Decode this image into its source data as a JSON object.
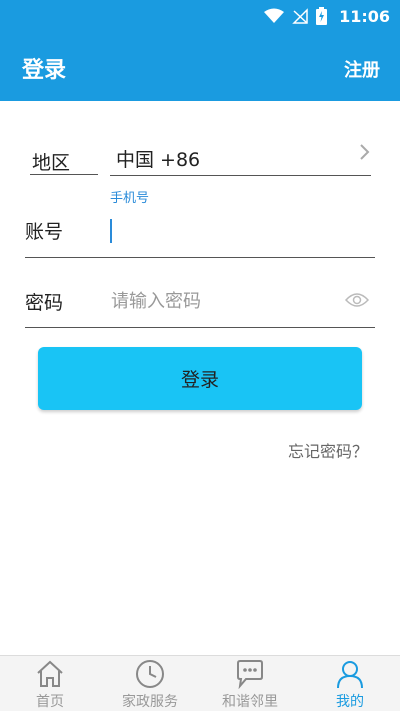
{
  "status_bar": {
    "time": "11:06"
  },
  "header": {
    "title": "登录",
    "register_label": "注册"
  },
  "form": {
    "region_label": "地区",
    "region_value": "中国 +86",
    "phone_hint": "手机号",
    "account_label": "账号",
    "account_value": "",
    "password_label": "密码",
    "password_placeholder": "请输入密码"
  },
  "login_button": "登录",
  "forgot_password": "忘记密码？",
  "tabs": [
    {
      "label": "首页",
      "icon": "home-icon",
      "active": false
    },
    {
      "label": "家政服务",
      "icon": "clock-icon",
      "active": false
    },
    {
      "label": "和谐邻里",
      "icon": "chat-icon",
      "active": false
    },
    {
      "label": "我的",
      "icon": "user-icon",
      "active": true
    }
  ],
  "colors": {
    "primary": "#1a9be0",
    "button": "#19c4f5",
    "hint": "#2a8bd9"
  }
}
